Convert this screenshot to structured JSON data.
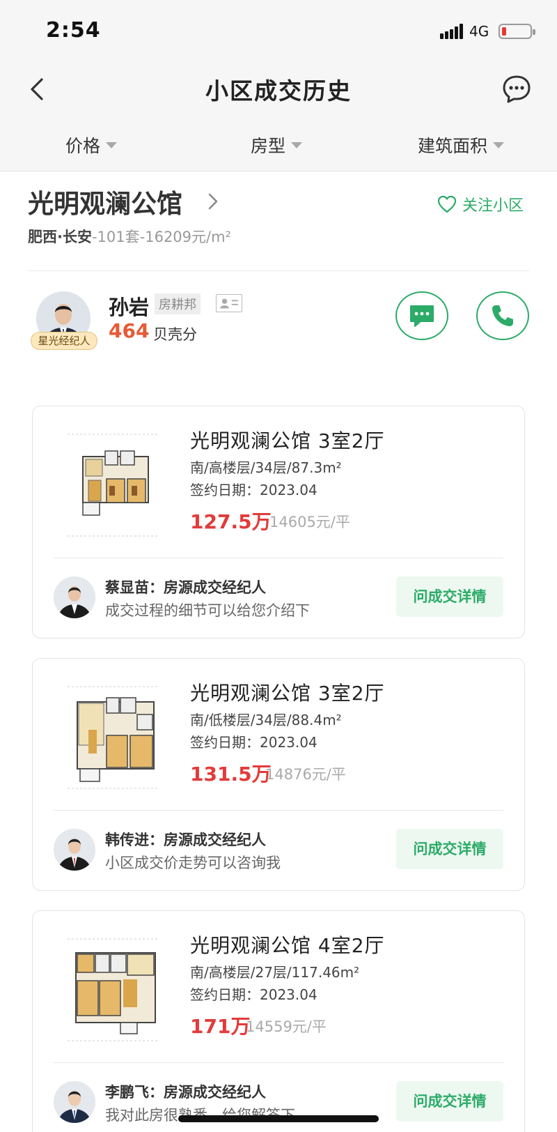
{
  "status_bar": {
    "time": "2:54",
    "network": "4G"
  },
  "nav": {
    "title": "小区成交历史",
    "back_icon": "chevron-left-icon",
    "message_icon": "chat-bubble-icon"
  },
  "filters": [
    {
      "label": "价格"
    },
    {
      "label": "房型"
    },
    {
      "label": "建筑面积"
    }
  ],
  "community": {
    "name": "光明观澜公馆",
    "follow_label": "关注小区",
    "location": "肥西·长安",
    "stats": "-101套-16209元/m²"
  },
  "agent": {
    "name": "孙岩",
    "tag": "房耕邦",
    "badge": "星光经纪人",
    "score": "464",
    "score_label": "贝壳分"
  },
  "listings": [
    {
      "title": "光明观澜公馆 3室2厅",
      "meta": "南/高楼层/34层/87.3m²",
      "date": "签约日期：2023.04",
      "price": "127.5万",
      "unit_price": "14605元/平",
      "broker_name": "蔡显苗：房源成交经纪人",
      "broker_desc": "成交过程的细节可以给您介绍下",
      "ask_label": "问成交详情"
    },
    {
      "title": "光明观澜公馆 3室2厅",
      "meta": "南/低楼层/34层/88.4m²",
      "date": "签约日期：2023.04",
      "price": "131.5万",
      "unit_price": "14876元/平",
      "broker_name": "韩传进：房源成交经纪人",
      "broker_desc": "小区成交价走势可以咨询我",
      "ask_label": "问成交详情"
    },
    {
      "title": "光明观澜公馆 4室2厅",
      "meta": "南/高楼层/27层/117.46m²",
      "date": "签约日期：2023.04",
      "price": "171万",
      "unit_price": "14559元/平",
      "broker_name": "李鹏飞：房源成交经纪人",
      "broker_desc": "我对此房很熟悉，给您解答下",
      "ask_label": "问成交详情"
    }
  ],
  "colors": {
    "accent": "#2bab67",
    "price": "#e23b3b",
    "score": "#e65a35"
  }
}
